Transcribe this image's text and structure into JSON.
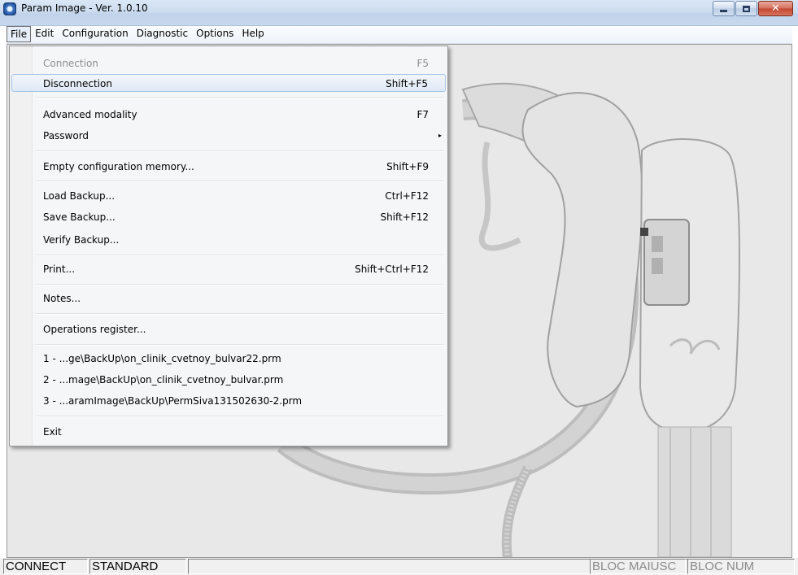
{
  "window": {
    "title": "Param Image - Ver. 1.0.10",
    "icon": "app-icon",
    "controls": [
      "minimize-icon",
      "maximize-icon",
      "close-icon"
    ]
  },
  "menubar": {
    "items": [
      {
        "label": "File",
        "active": true
      },
      {
        "label": "Edit"
      },
      {
        "label": "Configuration"
      },
      {
        "label": "Diagnostic"
      },
      {
        "label": "Options"
      },
      {
        "label": "Help"
      }
    ]
  },
  "file_menu": {
    "items": [
      {
        "label": "Connection",
        "shortcut": "F5",
        "disabled": true
      },
      {
        "label": "Disconnection",
        "shortcut": "Shift+F5",
        "highlighted": true
      },
      {
        "label": "Advanced modality",
        "shortcut": "F7"
      },
      {
        "label": "Password",
        "submenu": true
      },
      {
        "label": "Empty configuration memory...",
        "shortcut": "Shift+F9"
      },
      {
        "label": "Load Backup...",
        "shortcut": "Ctrl+F12"
      },
      {
        "label": "Save Backup...",
        "shortcut": "Shift+F12"
      },
      {
        "label": "Verify Backup..."
      },
      {
        "label": "Print...",
        "shortcut": "Shift+Ctrl+F12"
      },
      {
        "label": "Notes..."
      },
      {
        "label": "Operations register..."
      },
      {
        "label": "1 - ...ge\\BackUp\\on_clinik_cvetnoy_bulvar22.prm"
      },
      {
        "label": "2 - ...mage\\BackUp\\on_clinik_cvetnoy_bulvar.prm"
      },
      {
        "label": "3 - ...aramImage\\BackUp\\PermSiva131502630-2.prm"
      },
      {
        "label": "Exit"
      }
    ],
    "submenu_arrow": "▸"
  },
  "statusbar": {
    "connect": "CONNECT",
    "mode": "STANDARD",
    "caps": "BLOC MAIUSC",
    "num": "BLOC NUM"
  },
  "colors": {
    "title_bar": "#cddcef",
    "menu_bg": "#f5f6f7",
    "highlight_border": "#a8c4e6",
    "close_button": "#c2452e",
    "client_bg": "#e6e6e6"
  }
}
